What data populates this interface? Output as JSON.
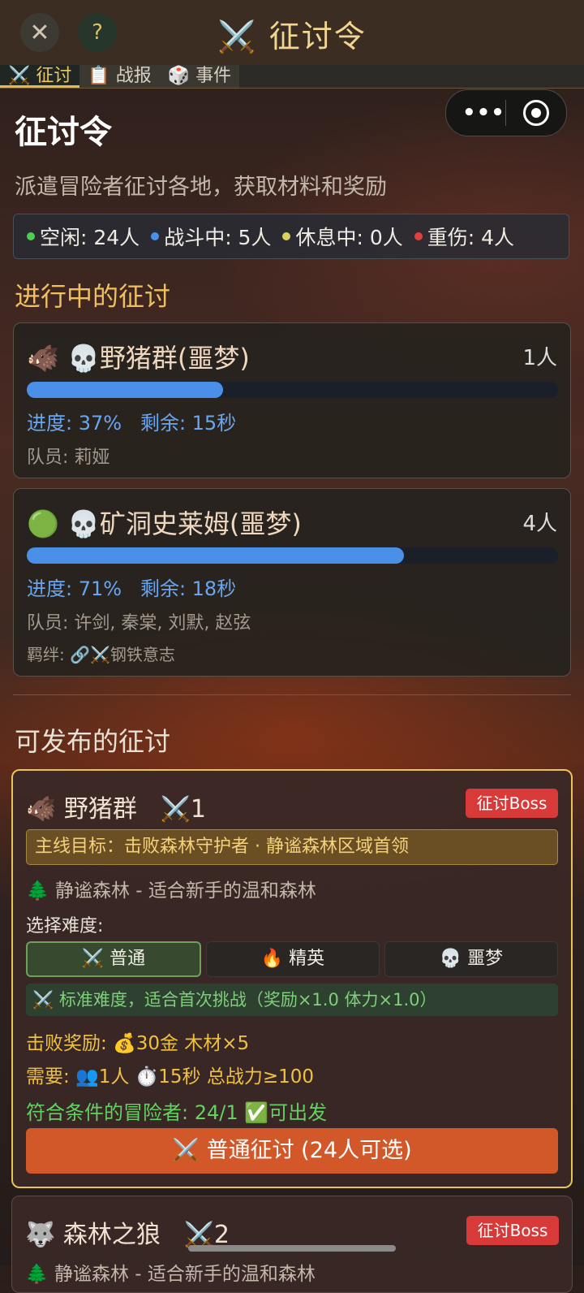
{
  "header": {
    "title": "⚔️ 征讨令",
    "close_icon": "✕",
    "help_icon": "?"
  },
  "tabs": [
    {
      "label": "⚔️ 征讨",
      "active": true
    },
    {
      "label": "📋 战报",
      "active": false
    },
    {
      "label": "🎲 事件",
      "active": false
    }
  ],
  "capsule": {
    "more": "•••"
  },
  "page": {
    "title": "征讨令",
    "description": "派遣冒险者征讨各地，获取材料和奖励"
  },
  "status": {
    "idle": "空闲: 24人",
    "fighting": "战斗中: 5人",
    "resting": "休息中: 0人",
    "injured": "重伤: 4人",
    "colors": {
      "idle": "#4ccf4c",
      "fighting": "#4a90e8",
      "resting": "#d8d060",
      "injured": "#e04040"
    }
  },
  "ongoing": {
    "section_title": "进行中的征讨",
    "missions": [
      {
        "icon": "🐗",
        "title": "💀野猪群(噩梦)",
        "count": "1人",
        "progress": 0.37,
        "progress_text": "进度: 37%",
        "remaining": "剩余: 15秒",
        "members": "队员: 莉娅"
      },
      {
        "icon": "🟢",
        "title": "💀矿洞史莱姆(噩梦)",
        "count": "4人",
        "progress": 0.71,
        "progress_text": "进度: 71%",
        "remaining": "剩余: 18秒",
        "members": "队员: 许剑, 秦棠, 刘默, 赵弦",
        "bond": "羁绊: 🔗⚔️钢铁意志"
      }
    ]
  },
  "available": {
    "section_title": "可发布的征讨",
    "quests": [
      {
        "icon": "🐗",
        "name": "野猪群",
        "level": "⚔️1",
        "badge": "征讨Boss",
        "mission": "主线目标：击败森林守护者 · 静谧森林区域首领",
        "location": "🌲 静谧森林 - 适合新手的温和森林",
        "difficulty_label": "选择难度:",
        "difficulties": [
          "⚔️ 普通",
          "🔥 精英",
          "💀 噩梦"
        ],
        "selected_difficulty": 0,
        "difficulty_note": "⚔️ 标准难度，适合首次挑战（奖励×1.0 体力×1.0）",
        "rewards": "击败奖励: 💰30金 木材×5",
        "requirements": "需要: 👥1人 ⏱️15秒 总战力≥100",
        "eligible": "符合条件的冒险者: 24/1 ✅可出发",
        "launch_button": "⚔️ 普通征讨 (24人可选)"
      },
      {
        "icon": "🐺",
        "name": "森林之狼",
        "level": "⚔️2",
        "badge": "征讨Boss",
        "location": "🌲 静谧森林 - 适合新手的温和森林"
      }
    ]
  }
}
